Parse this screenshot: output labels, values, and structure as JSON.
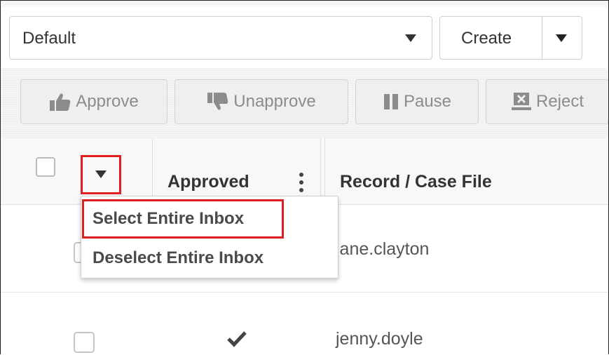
{
  "view_select": {
    "value": "Default"
  },
  "create_button": {
    "label": "Create"
  },
  "toolbar": {
    "approve": "Approve",
    "unapprove": "Unapprove",
    "pause": "Pause",
    "reject": "Reject"
  },
  "grid": {
    "columns": {
      "approved": "Approved",
      "record": "Record / Case File"
    },
    "rows": [
      {
        "approved": false,
        "record": "jane.clayton"
      },
      {
        "approved": true,
        "record": "jenny.doyle"
      }
    ]
  },
  "select_menu": {
    "items": [
      "Select Entire Inbox",
      "Deselect Entire Inbox"
    ]
  },
  "colors": {
    "highlight": "#e02020"
  }
}
